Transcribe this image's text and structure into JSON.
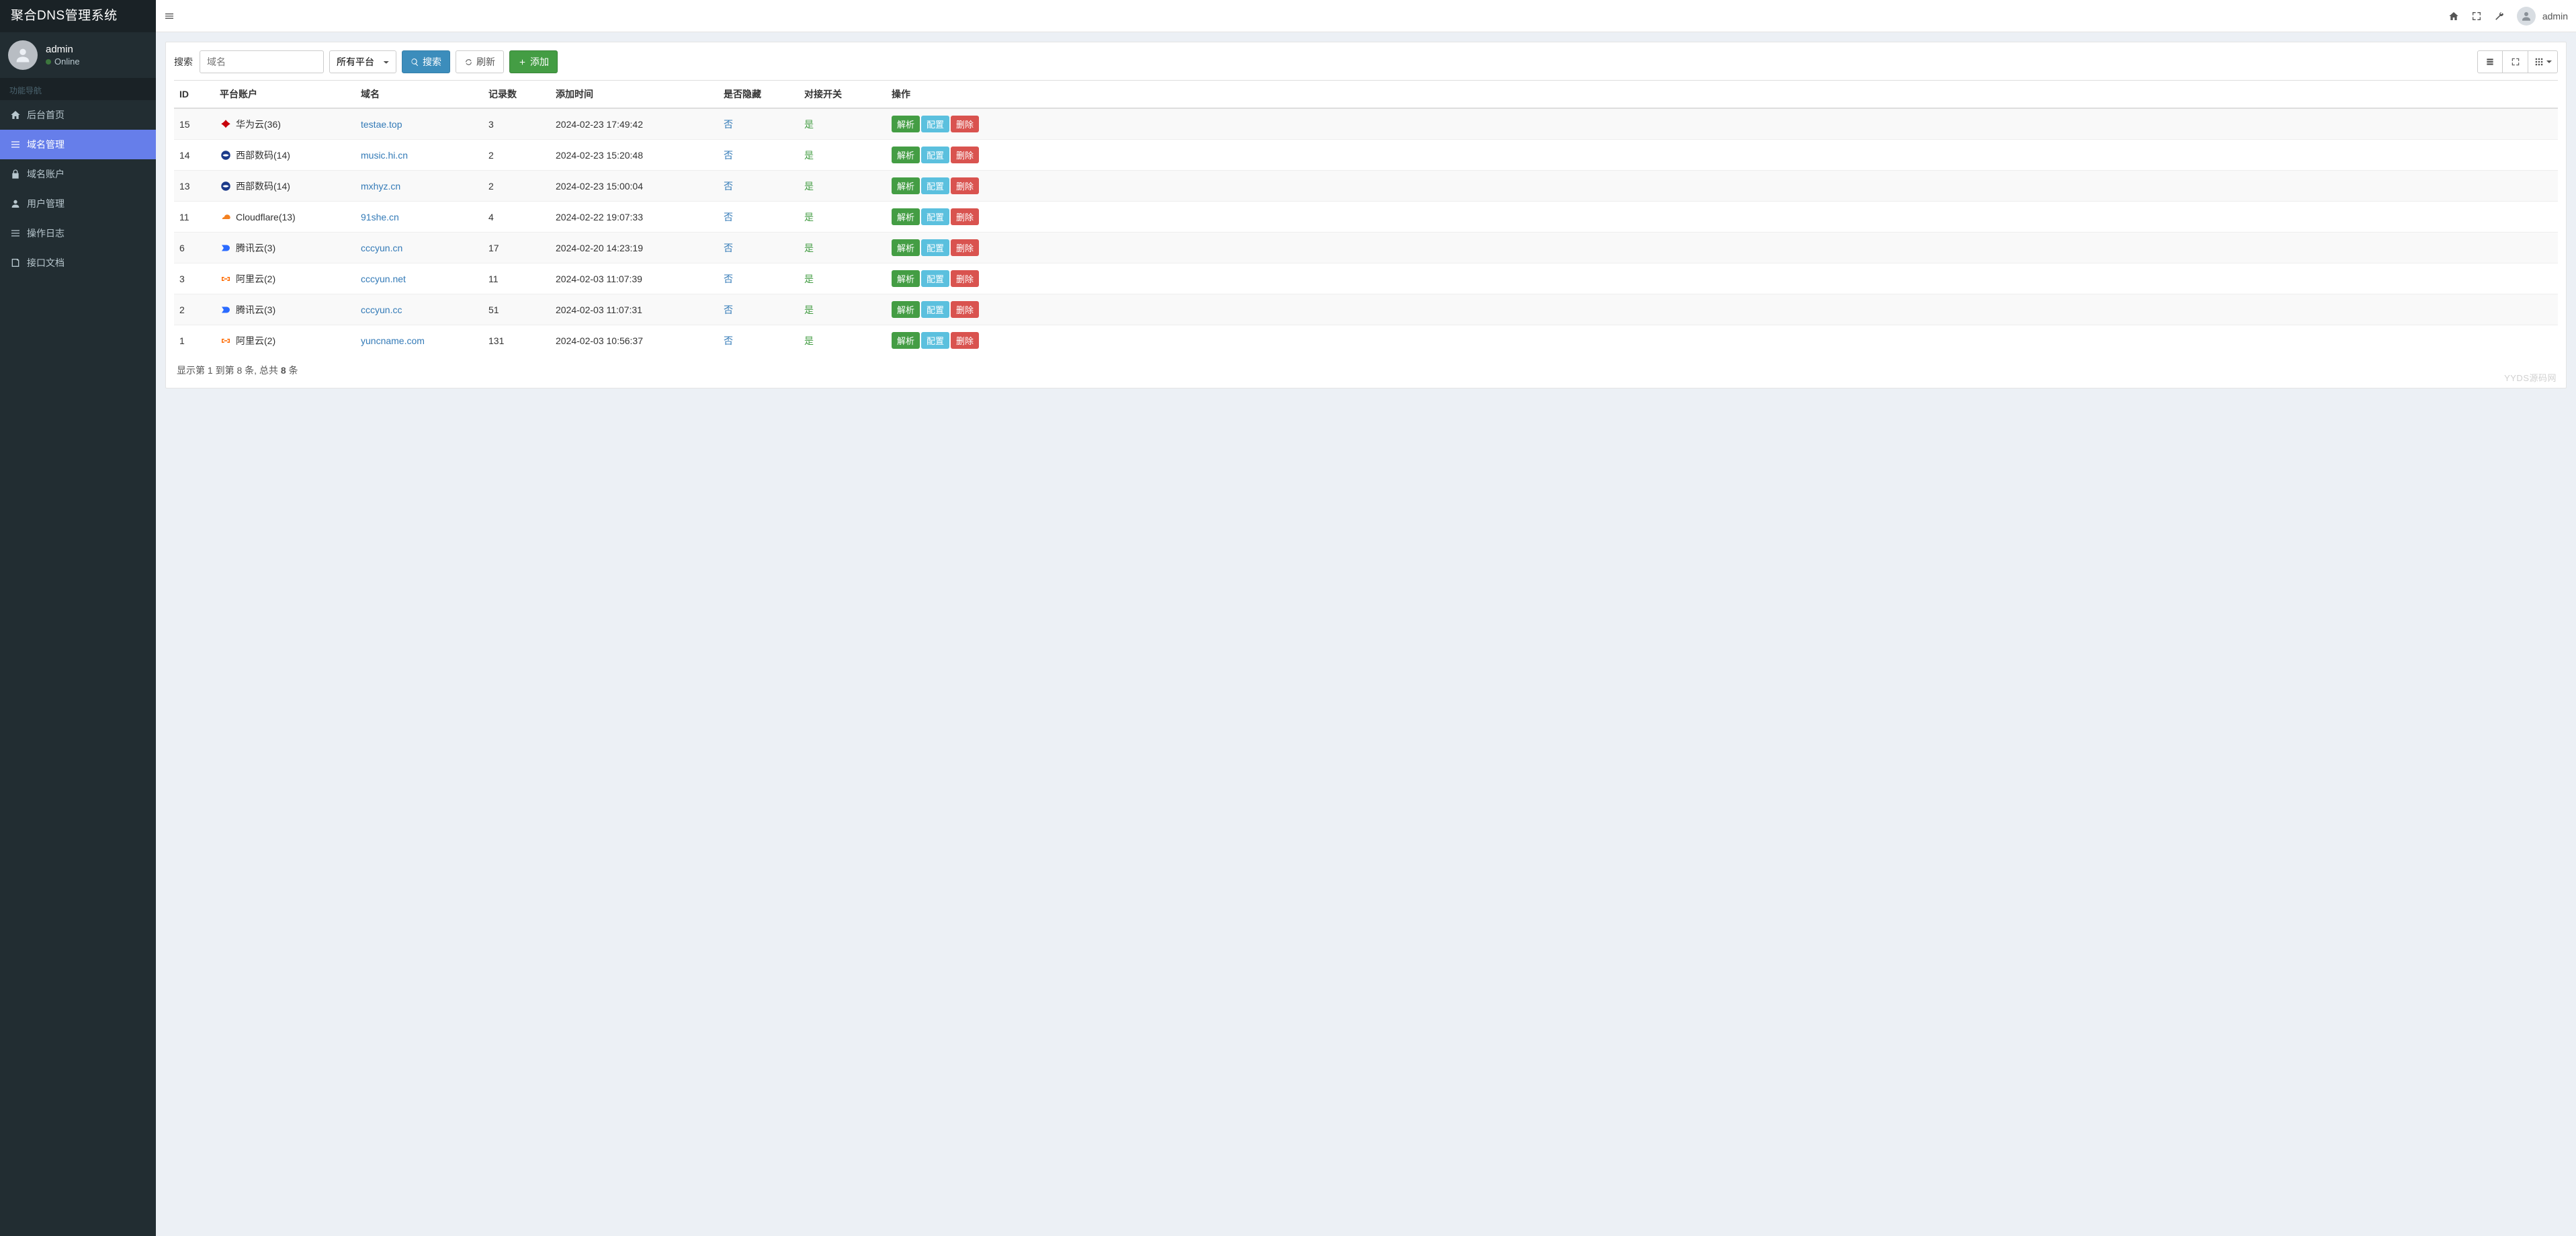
{
  "brand": "聚合DNS管理系统",
  "user": {
    "name": "admin",
    "status": "Online"
  },
  "nav": {
    "header": "功能导航",
    "items": [
      {
        "key": "dashboard",
        "label": "后台首页"
      },
      {
        "key": "domains",
        "label": "域名管理",
        "active": true
      },
      {
        "key": "accounts",
        "label": "域名账户"
      },
      {
        "key": "users",
        "label": "用户管理"
      },
      {
        "key": "logs",
        "label": "操作日志"
      },
      {
        "key": "api",
        "label": "接口文档"
      }
    ]
  },
  "topbar": {
    "username": "admin"
  },
  "toolbar": {
    "search_label": "搜索",
    "domain_placeholder": "域名",
    "platform_selected": "所有平台",
    "search_btn": "搜索",
    "refresh_btn": "刷新",
    "add_btn": "添加"
  },
  "columns": {
    "id": "ID",
    "platform": "平台账户",
    "domain": "域名",
    "records": "记录数",
    "time": "添加时间",
    "hidden": "是否隐藏",
    "switch": "对接开关",
    "actions": "操作"
  },
  "action_labels": {
    "parse": "解析",
    "config": "配置",
    "delete": "删除"
  },
  "rows": [
    {
      "id": "15",
      "platform": "华为云(36)",
      "icon": "huawei",
      "domain": "testae.top",
      "records": "3",
      "time": "2024-02-23 17:49:42",
      "hidden": "否",
      "switch": "是"
    },
    {
      "id": "14",
      "platform": "西部数码(14)",
      "icon": "west",
      "domain": "music.hi.cn",
      "records": "2",
      "time": "2024-02-23 15:20:48",
      "hidden": "否",
      "switch": "是"
    },
    {
      "id": "13",
      "platform": "西部数码(14)",
      "icon": "west",
      "domain": "mxhyz.cn",
      "records": "2",
      "time": "2024-02-23 15:00:04",
      "hidden": "否",
      "switch": "是"
    },
    {
      "id": "11",
      "platform": "Cloudflare(13)",
      "icon": "cloudflare",
      "domain": "91she.cn",
      "records": "4",
      "time": "2024-02-22 19:07:33",
      "hidden": "否",
      "switch": "是"
    },
    {
      "id": "6",
      "platform": "腾讯云(3)",
      "icon": "tencent",
      "domain": "cccyun.cn",
      "records": "17",
      "time": "2024-02-20 14:23:19",
      "hidden": "否",
      "switch": "是"
    },
    {
      "id": "3",
      "platform": "阿里云(2)",
      "icon": "aliyun",
      "domain": "cccyun.net",
      "records": "11",
      "time": "2024-02-03 11:07:39",
      "hidden": "否",
      "switch": "是"
    },
    {
      "id": "2",
      "platform": "腾讯云(3)",
      "icon": "tencent",
      "domain": "cccyun.cc",
      "records": "51",
      "time": "2024-02-03 11:07:31",
      "hidden": "否",
      "switch": "是"
    },
    {
      "id": "1",
      "platform": "阿里云(2)",
      "icon": "aliyun",
      "domain": "yuncname.com",
      "records": "131",
      "time": "2024-02-03 10:56:37",
      "hidden": "否",
      "switch": "是"
    }
  ],
  "pagination": {
    "prefix": "显示第 1 到第 8 条, 总共 ",
    "total": "8",
    "suffix": " 条"
  },
  "watermark": "YYDS源码网"
}
